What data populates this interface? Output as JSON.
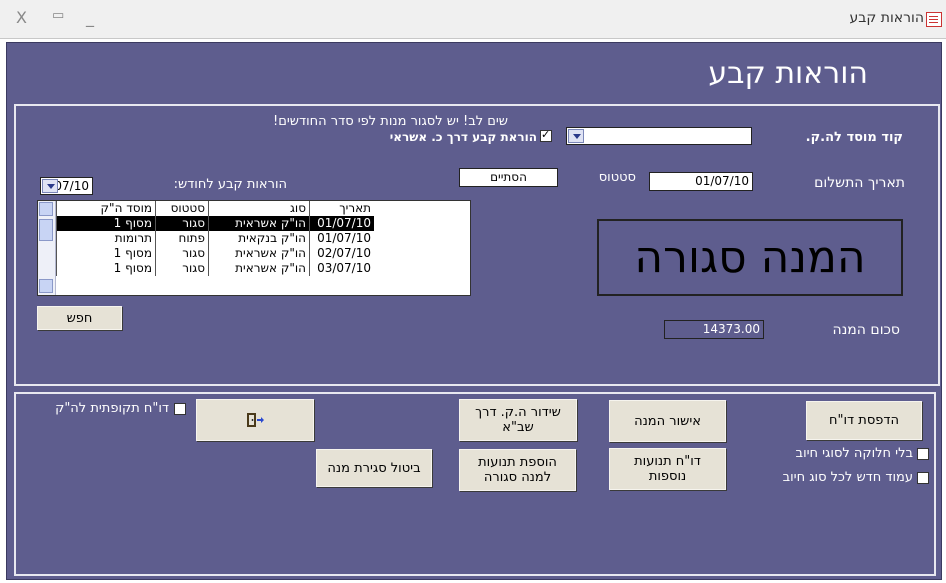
{
  "window": {
    "title": "הוראות קבע",
    "controls": {
      "close": "X",
      "maximize": "▭",
      "minimize": "_"
    }
  },
  "form": {
    "heading": "הוראות קבע",
    "warning": "שים לב! יש לסגור מנות לפי סדר החודשים!",
    "institution_code_label": "קוד מוסד לה.ק.",
    "institution_code_value": "",
    "credit_checkbox_label": "הוראת קבע דרך כ. אשראי",
    "credit_checkbox_checked": true,
    "payment_date_label": "תאריך התשלום",
    "payment_date_value": "01/07/10",
    "status_label": "סטטוס",
    "status_value": "הסתיים",
    "month_label": "הוראות קבע לחודש:",
    "month_value": "07/10",
    "batch_status_text": "המנה סגורה",
    "batch_total_label": "סכום המנה",
    "batch_total_value": "14373.00",
    "search_button": "חפש"
  },
  "list": {
    "headers": {
      "date": "תאריך",
      "type": "סוג",
      "status": "סטטוס",
      "code": "מוסד ה\"ק"
    },
    "rows": [
      {
        "date": "01/07/10",
        "type": "הו\"ק אשראית",
        "status": "סגור",
        "code": "מסוף 1",
        "selected": true
      },
      {
        "date": "01/07/10",
        "type": "הו\"ק בנקאית",
        "status": "פתוח",
        "code": "תרומות",
        "selected": false
      },
      {
        "date": "02/07/10",
        "type": "הו\"ק אשראית",
        "status": "סגור",
        "code": "מסוף 1",
        "selected": false
      },
      {
        "date": "03/07/10",
        "type": "הו\"ק אשראית",
        "status": "סגור",
        "code": "מסוף 1",
        "selected": false
      }
    ]
  },
  "actions": {
    "print_report": "הדפסת דו\"ח",
    "approve_batch": "אישור המנה",
    "send_hq": "שידור ה.ק. דרך\nשב\"א",
    "exit_icon": "exit-door-icon",
    "additional_transactions_report": "דו\"ח תנועות\nנוספות",
    "add_transactions_closed": "הוספת תנועות\nלמנה סגורה",
    "cancel_batch_close": "ביטול סגירת מנה",
    "periodic_report_label": "דו\"ח תקופתית לה\"ק",
    "no_split_label": "בלי חלוקה לסוגי חיוב",
    "new_column_label": "עמוד חדש  לכל סוג חיוב"
  },
  "colors": {
    "form_background": "#5e5d8e",
    "button_face": "#e6e2d6",
    "selected_row": "#000000"
  }
}
